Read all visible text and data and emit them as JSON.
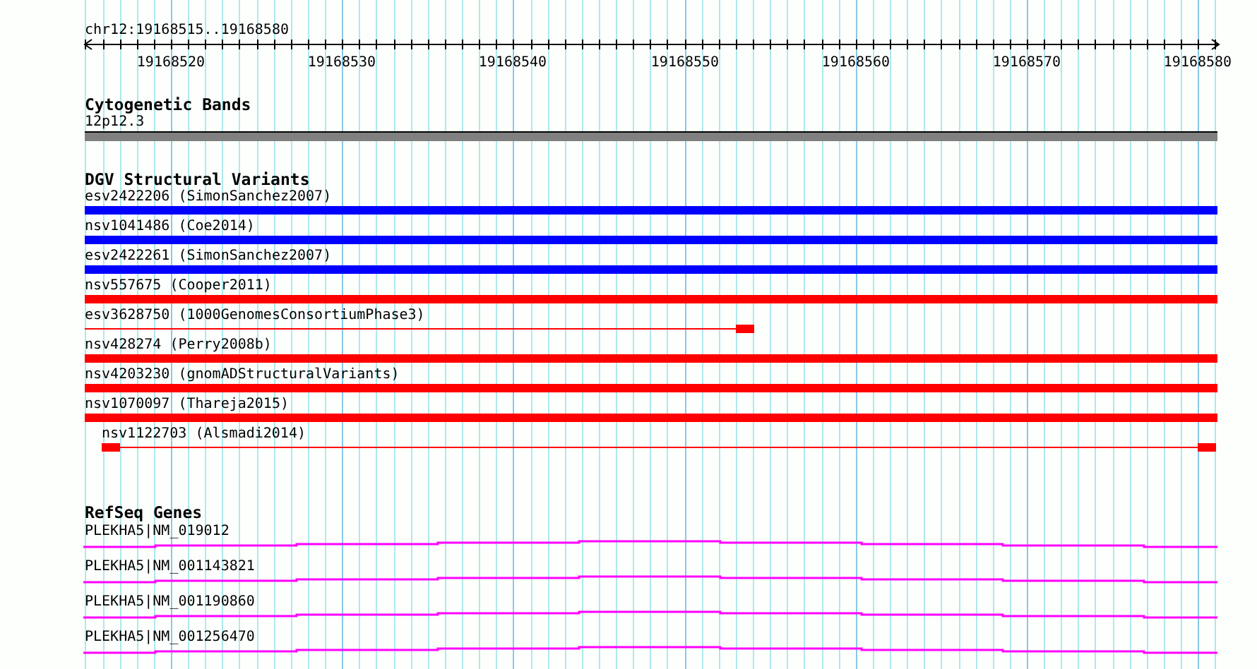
{
  "locus": "chr12:19168515..19168580",
  "ruler": {
    "labels": [
      "19168520",
      "19168530",
      "19168540",
      "19168550",
      "19168560",
      "19168570",
      "19168580"
    ]
  },
  "tracks": [
    {
      "kind": "bands",
      "title": "Cytogenetic Bands",
      "features": [
        {
          "label": "12p12.3"
        }
      ]
    },
    {
      "kind": "variants",
      "title": "DGV Structural Variants",
      "features": [
        {
          "label": "esv2422206 (SimonSanchez2007)",
          "color": "#0000ff",
          "kind": "bar"
        },
        {
          "label": "nsv1041486 (Coe2014)",
          "color": "#0000ff",
          "kind": "bar"
        },
        {
          "label": "esv2422261 (SimonSanchez2007)",
          "color": "#0000ff",
          "kind": "bar"
        },
        {
          "label": "nsv557675 (Cooper2011)",
          "color": "#ff0000",
          "kind": "bar"
        },
        {
          "label": "esv3628750 (1000GenomesConsortiumPhase3)",
          "color": "#ff0000",
          "kind": "gapped"
        },
        {
          "label": "nsv428274 (Perry2008b)",
          "color": "#ff0000",
          "kind": "bar"
        },
        {
          "label": "nsv4203230 (gnomADStructuralVariants)",
          "color": "#ff0000",
          "kind": "bar"
        },
        {
          "label": "nsv1070097 (Thareja2015)",
          "color": "#ff0000",
          "kind": "bar"
        },
        {
          "label": "nsv1122703 (Alsmadi2014)",
          "color": "#ff0000",
          "kind": "gapped"
        }
      ]
    },
    {
      "kind": "genes",
      "title": "RefSeq Genes",
      "features": [
        {
          "label": "PLEKHA5|NM_019012"
        },
        {
          "label": "PLEKHA5|NM_001143821"
        },
        {
          "label": "PLEKHA5|NM_001190860"
        },
        {
          "label": "PLEKHA5|NM_001256470"
        }
      ]
    }
  ]
}
